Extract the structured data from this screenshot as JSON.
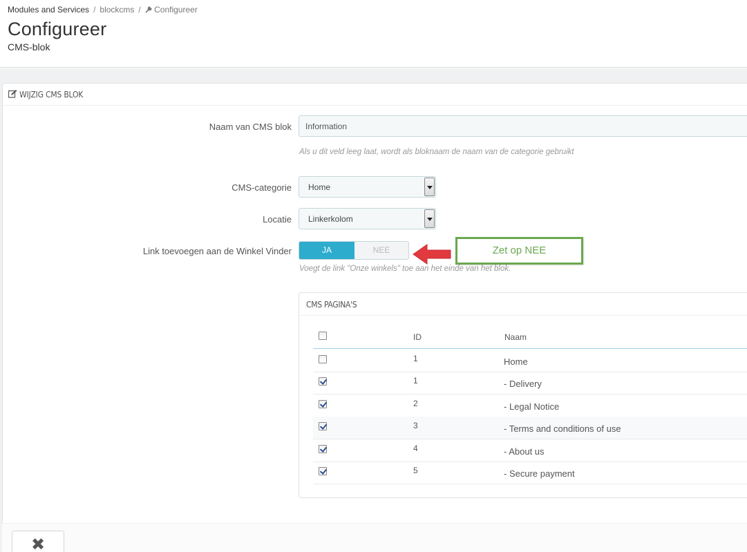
{
  "breadcrumb": {
    "item1": "Modules and Services",
    "item2": "blockcms",
    "item3": "Configureer",
    "separator": "/"
  },
  "page": {
    "title": "Configureer",
    "subtitle": "CMS-blok"
  },
  "panel": {
    "title": "WIJZIG CMS BLOK",
    "icon": "edit-icon"
  },
  "form": {
    "name_label": "Naam van CMS blok",
    "name_value": "Information",
    "name_help": "Als u dit veld leeg laat, wordt als bloknaam de naam van de categorie gebruikt",
    "category_label": "CMS-categorie",
    "category_value": "Home",
    "location_label": "Locatie",
    "location_value": "Linkerkolom",
    "storelink_label": "Link toevoegen aan de Winkel Vinder",
    "storelink_yes": "JA",
    "storelink_no": "NEE",
    "storelink_selected": "JA",
    "storelink_help": "Voegt de link \"Onze winkels\" toe aan het einde van het blok."
  },
  "annotation": {
    "callout_text": "Zet op NEE",
    "arrow_color": "#e0393e",
    "callout_color": "#6aa84f"
  },
  "cms_pages": {
    "title": "CMS PAGINA'S",
    "col_id": "ID",
    "col_name": "Naam",
    "rows": [
      {
        "checked": false,
        "id": "1",
        "name": "Home"
      },
      {
        "checked": true,
        "id": "1",
        "name": "- Delivery"
      },
      {
        "checked": true,
        "id": "2",
        "name": "- Legal Notice"
      },
      {
        "checked": true,
        "id": "3",
        "name": "- Terms and conditions of use"
      },
      {
        "checked": true,
        "id": "4",
        "name": "- About us"
      },
      {
        "checked": true,
        "id": "5",
        "name": "- Secure payment"
      }
    ]
  },
  "footer": {
    "cancel_icon": "close-icon"
  },
  "colors": {
    "switch_active": "#2eacce",
    "background": "#eff1f2"
  }
}
